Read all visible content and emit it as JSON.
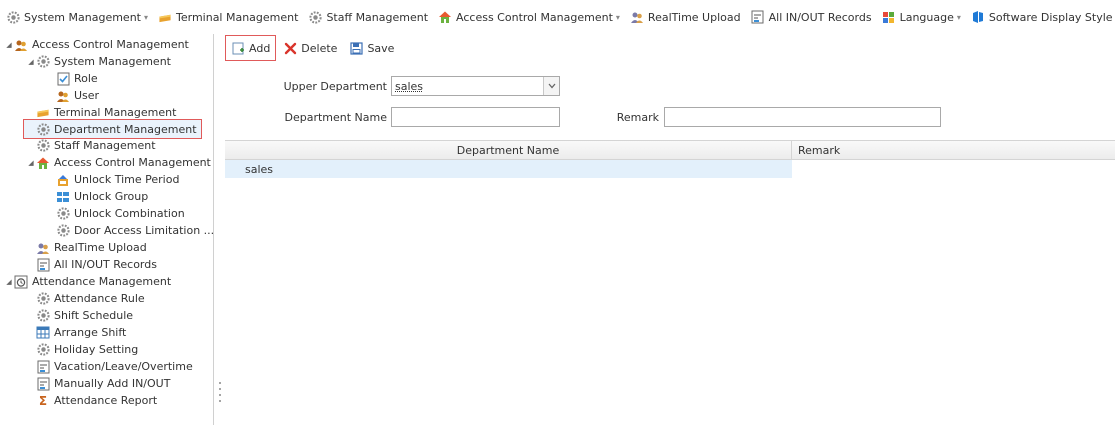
{
  "menubar": {
    "items": [
      {
        "label": "System Management",
        "icon": "gear-icon",
        "dropdown": true
      },
      {
        "label": "Terminal Management",
        "icon": "terminal-icon",
        "dropdown": false
      },
      {
        "label": "Staff Management",
        "icon": "gear-icon",
        "dropdown": false
      },
      {
        "label": "Access Control Management",
        "icon": "house-icon",
        "dropdown": true
      },
      {
        "label": "RealTime Upload",
        "icon": "people-icon",
        "dropdown": false
      },
      {
        "label": "All IN/OUT Records",
        "icon": "record-icon",
        "dropdown": false
      },
      {
        "label": "Language",
        "icon": "language-icon",
        "dropdown": true
      },
      {
        "label": "Software Display Style",
        "icon": "display-style-icon",
        "dropdown": true
      }
    ]
  },
  "tree": {
    "items": [
      {
        "label": "Access Control Management",
        "icon": "people-icon",
        "expanded": true
      },
      {
        "label": "System Management",
        "icon": "gear-icon",
        "expanded": true
      },
      {
        "label": "Role",
        "icon": "role-icon"
      },
      {
        "label": "User",
        "icon": "user-icon"
      },
      {
        "label": "Terminal Management",
        "icon": "terminal-icon"
      },
      {
        "label": "Department Management",
        "icon": "gear-icon",
        "selected": true
      },
      {
        "label": "Staff Management",
        "icon": "gear-icon"
      },
      {
        "label": "Access Control Management",
        "icon": "house-icon",
        "expanded": true
      },
      {
        "label": "Unlock Time Period",
        "icon": "time-period-icon"
      },
      {
        "label": "Unlock Group",
        "icon": "group-icon"
      },
      {
        "label": "Unlock Combination",
        "icon": "gear-icon"
      },
      {
        "label": "Door Access Limitation ...",
        "icon": "gear-icon"
      },
      {
        "label": "RealTime Upload",
        "icon": "people-icon"
      },
      {
        "label": "All IN/OUT Records",
        "icon": "record-icon"
      },
      {
        "label": "Attendance Management",
        "icon": "calendar-icon",
        "expanded": true
      },
      {
        "label": "Attendance Rule",
        "icon": "gear-icon"
      },
      {
        "label": "Shift Schedule",
        "icon": "gear-icon"
      },
      {
        "label": "Arrange Shift",
        "icon": "table-icon"
      },
      {
        "label": "Holiday Setting",
        "icon": "gear-icon"
      },
      {
        "label": "Vacation/Leave/Overtime",
        "icon": "record-icon"
      },
      {
        "label": "Manually Add IN/OUT",
        "icon": "record-icon"
      },
      {
        "label": "Attendance Report",
        "icon": "sigma-icon"
      }
    ]
  },
  "toolbar": {
    "add_label": "Add",
    "delete_label": "Delete",
    "save_label": "Save"
  },
  "form": {
    "upper_department_label": "Upper Department",
    "upper_department_value": "sales",
    "department_name_label": "Department Name",
    "department_name_value": "",
    "remark_label": "Remark",
    "remark_value": ""
  },
  "grid": {
    "columns": [
      "Department Name",
      "Remark"
    ],
    "rows": [
      {
        "department_name": "sales",
        "remark": ""
      }
    ]
  },
  "colors": {
    "highlight_border": "#e05a5a",
    "selected_row_bg": "#e3f0fb",
    "delete_red": "#d9342b"
  }
}
